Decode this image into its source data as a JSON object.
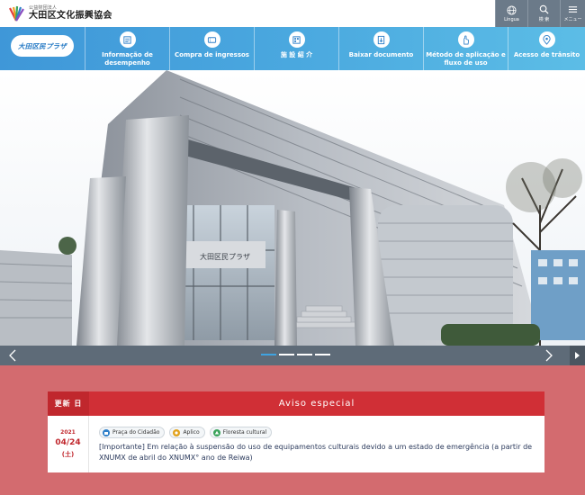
{
  "header": {
    "logo_sub": "公益財団法人",
    "logo_main": "大田区文化振興協会",
    "util": [
      {
        "label": "Língua",
        "icon": "globe-icon"
      },
      {
        "label": "検 索",
        "icon": "search-icon"
      },
      {
        "label": "メニュー",
        "icon": "menu-icon"
      }
    ]
  },
  "nav": {
    "brand": "大田区民プラザ",
    "items": [
      {
        "label": "Informação de desempenho",
        "icon": "performance-icon"
      },
      {
        "label": "Compra de ingressos",
        "icon": "ticket-icon"
      },
      {
        "label": "施 設 紹 介",
        "icon": "facility-icon"
      },
      {
        "label": "Baixar documento",
        "icon": "download-icon"
      },
      {
        "label": "Método de aplicação e fluxo de uso",
        "icon": "hand-icon"
      },
      {
        "label": "Acesso de trânsito",
        "icon": "map-pin-icon"
      }
    ]
  },
  "hero": {
    "building_sign": "大田区民プラザ",
    "slide_count": 4,
    "active_slide": 0
  },
  "notice": {
    "left_header": "更新 日",
    "right_header": "Aviso especial",
    "date_year": "2021",
    "date_md": "04/24",
    "date_day": "(土)",
    "tags": [
      {
        "label": "Praça do Cidadão",
        "icon": "plaza-icon",
        "color": "#2f80c9"
      },
      {
        "label": "Aplico",
        "icon": "aplico-icon",
        "color": "#e2a21c"
      },
      {
        "label": "Floresta cultural",
        "icon": "forest-icon",
        "color": "#3aa35a"
      }
    ],
    "text": "[Importante] Em relação à suspensão do uso de equipamentos culturais devido a um estado de emergência (a partir de XNUMX de abril do XNUMX° ano de Reiwa)"
  },
  "colors": {
    "nav_start": "#3f97d8",
    "nav_end": "#5cbde6",
    "notice_bg": "#d36b6f",
    "notice_header": "#d02f36",
    "date_red": "#c0272d",
    "util_bg": "#6b7a89"
  }
}
